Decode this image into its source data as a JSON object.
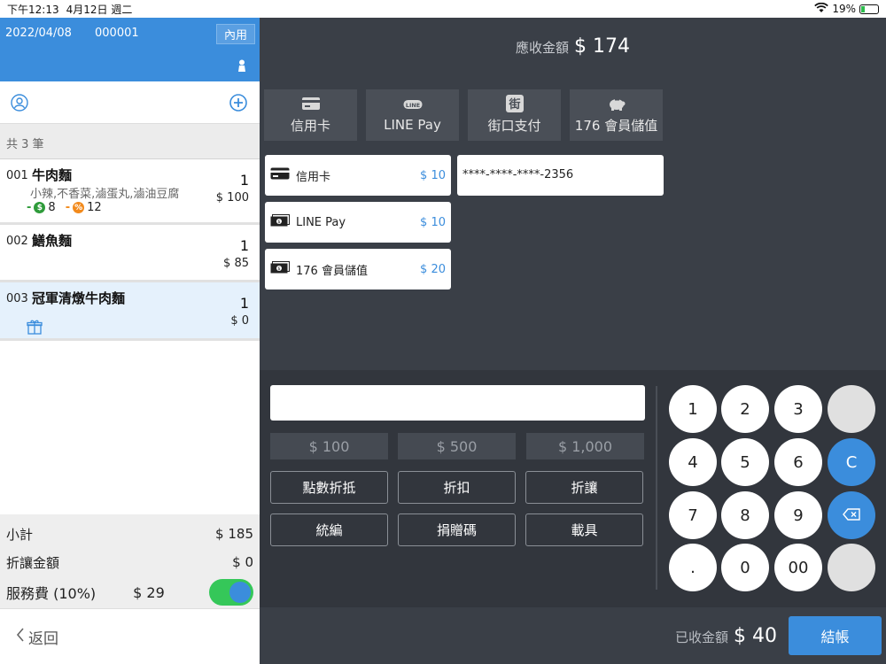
{
  "statusbar": {
    "time": "下午12:13",
    "date": "4月12日 週二",
    "battery": "19%"
  },
  "order": {
    "date": "2022/04/08",
    "number": "000001",
    "dine_type": "內用",
    "count_text": "共 3 筆"
  },
  "items": [
    {
      "num": "001",
      "name": "牛肉麵",
      "mods": "小辣,不香菜,滷蛋丸,滷油豆腐",
      "qty": "1",
      "price": "$ 100",
      "points": "8",
      "discount": "12"
    },
    {
      "num": "002",
      "name": "鱔魚麵",
      "qty": "1",
      "price": "$ 85"
    },
    {
      "num": "003",
      "name": "冠軍清燉牛肉麵",
      "qty": "1",
      "price": "$ 0"
    }
  ],
  "summary": {
    "subtotal_label": "小計",
    "subtotal": "$ 185",
    "discount_label": "折讓金額",
    "discount": "$ 0",
    "service_label": "服務費 (10%)",
    "service": "$ 29"
  },
  "back_label": "返回",
  "due": {
    "label": "應收金額",
    "value": "$ 174"
  },
  "methods": [
    {
      "label": "信用卡",
      "icon": "credit-card-icon"
    },
    {
      "label": "LINE Pay",
      "icon": "line-icon"
    },
    {
      "label": "街口支付",
      "icon": "jko-icon"
    },
    {
      "label": "176 會員儲值",
      "icon": "piggy-bank-icon"
    }
  ],
  "payments": [
    {
      "name": "信用卡",
      "amount": "$ 10"
    },
    {
      "name": "LINE Pay",
      "amount": "$ 10"
    },
    {
      "name": "176 會員儲值",
      "amount": "$ 20"
    }
  ],
  "card_number": "****-****-****-2356",
  "quick_amounts": [
    "$ 100",
    "$ 500",
    "$ 1,000"
  ],
  "actions": [
    "點數折抵",
    "折扣",
    "折讓",
    "統編",
    "捐贈碼",
    "載具"
  ],
  "keys": [
    "1",
    "2",
    "3",
    "",
    "4",
    "5",
    "6",
    "C",
    "7",
    "8",
    "9",
    "⌫",
    ".",
    "0",
    "00",
    ""
  ],
  "received": {
    "label": "已收金額",
    "value": "$ 40"
  },
  "checkout_label": "結帳",
  "colors": {
    "accent": "#3b8ddc",
    "panel": "#3a3f47",
    "toggle_on": "#35c759"
  }
}
